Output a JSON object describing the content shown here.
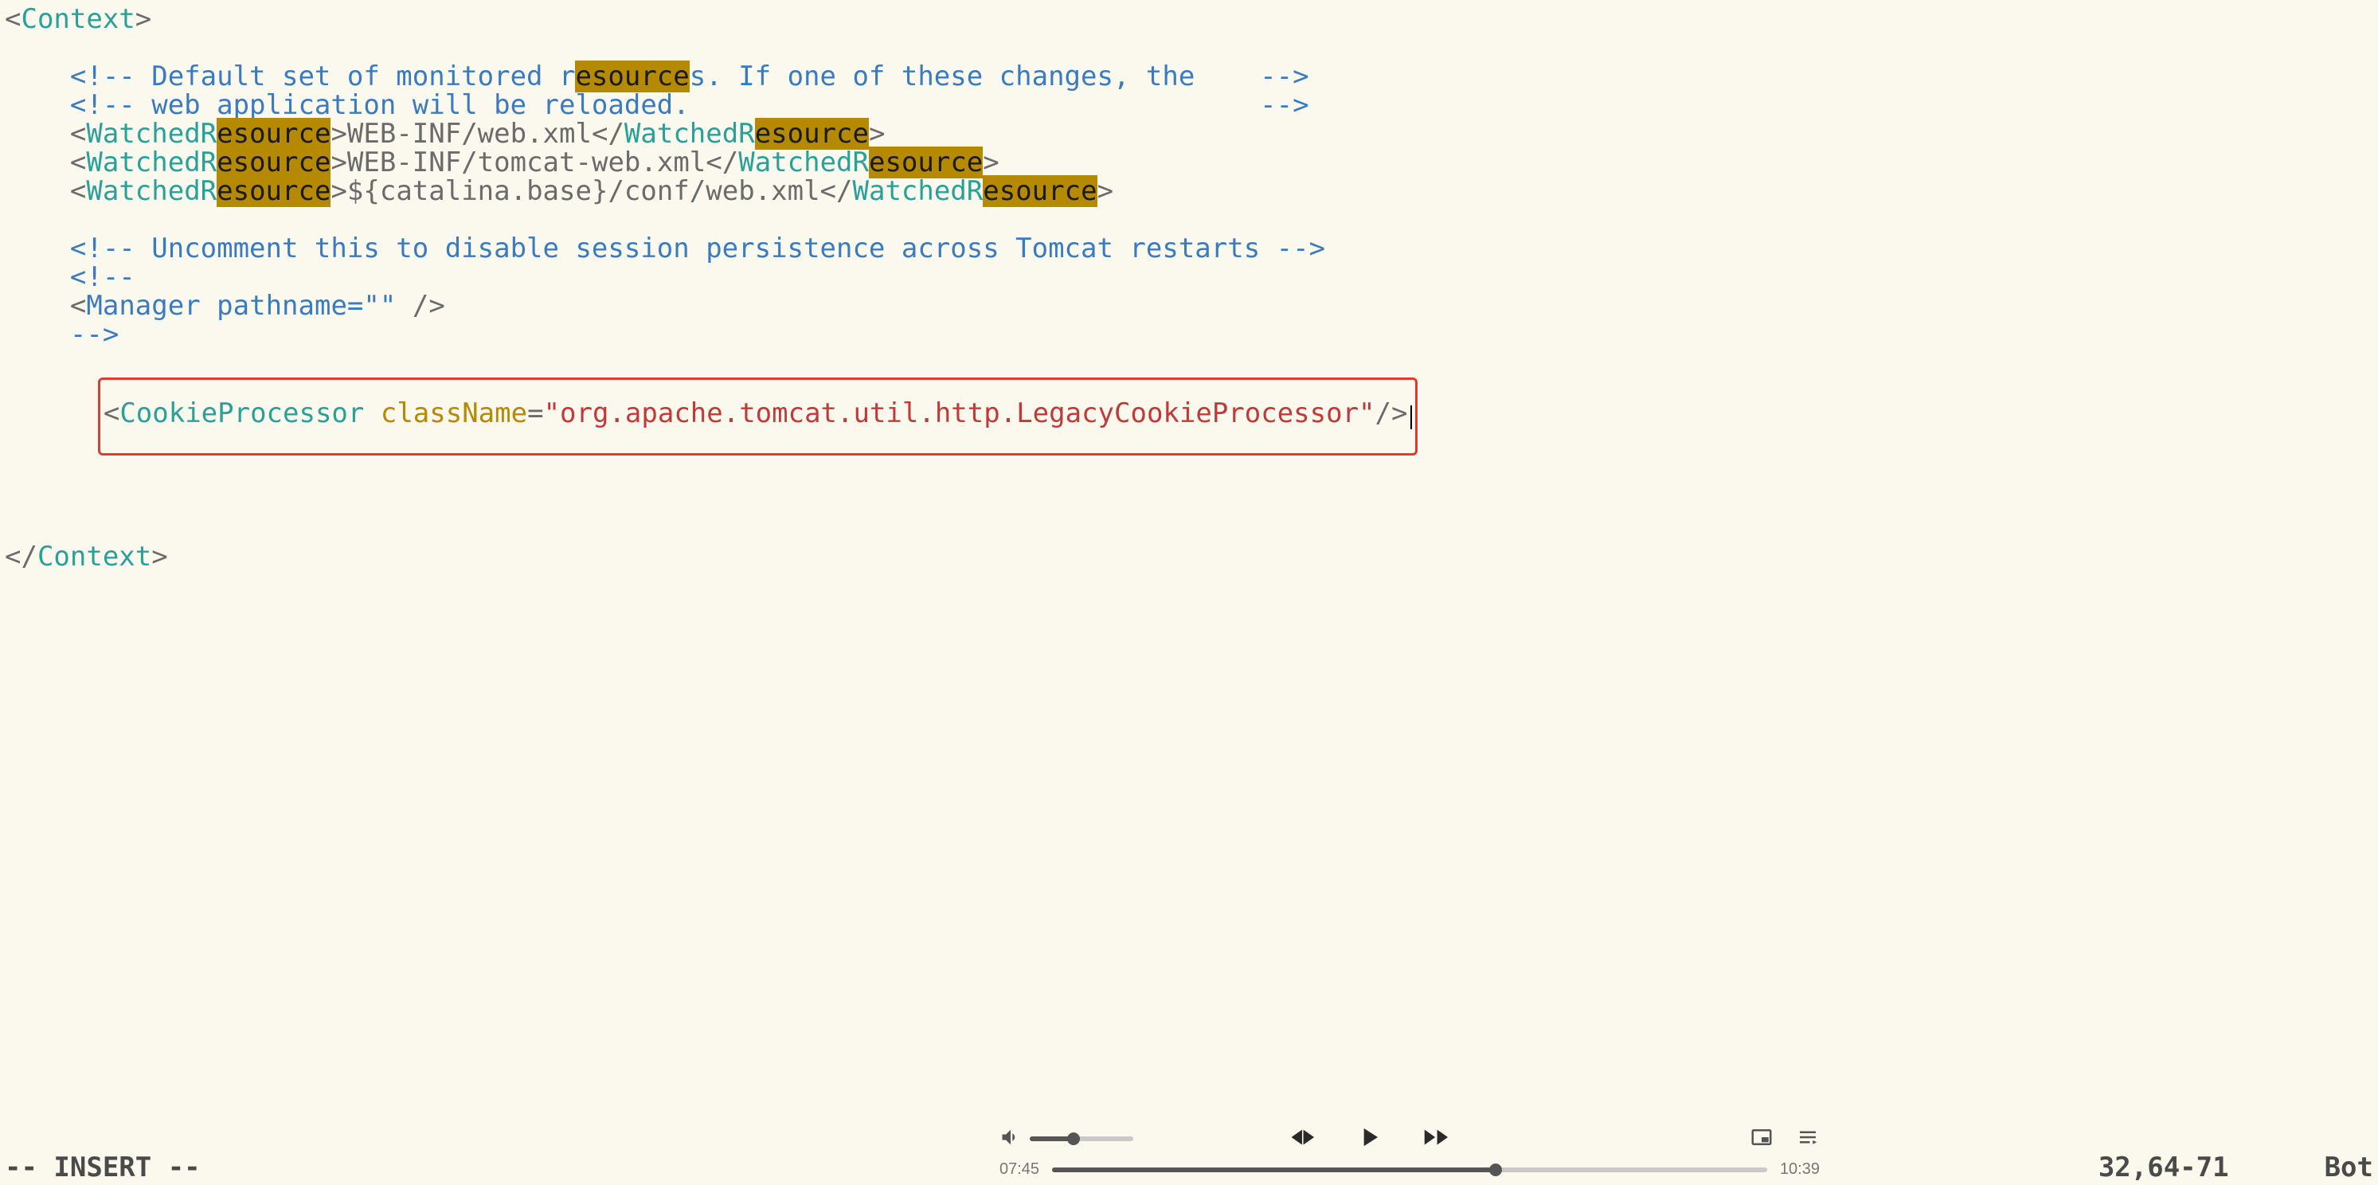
{
  "search_highlight": "esource",
  "code": {
    "context_open": "Context",
    "context_close": "Context",
    "comment1a": "<!-- Default set of monitored r",
    "comment1b": "s. If one of these changes, the    -->",
    "comment2": "<!-- web application will be reloaded.                                   -->",
    "wr_tag": "WatchedR",
    "wr_tag_tail": "",
    "wr1_text": "WEB-INF/web.xml",
    "wr2_text": "WEB-INF/tomcat-web.xml",
    "wr3_text": "${catalina.base}/conf/web.xml",
    "comment3": "<!-- Uncomment this to disable session persistence across Tomcat restarts -->",
    "comment4": "<!--",
    "mgr_tag": "Manager",
    "mgr_attr": "pathname",
    "mgr_val": "\"\"",
    "comment5": "-->",
    "cp_tag": "CookieProcessor",
    "cp_attr": "className",
    "cp_val": "\"org.apache.tomcat.util.http.LegacyCookieProcessor\""
  },
  "ruler": {
    "mode": "-- INSERT --",
    "pos": "32,64-71",
    "loc": "Bot"
  },
  "player": {
    "volume_pct": 42,
    "elapsed": "07:45",
    "total": "10:39",
    "seek_pct": 62
  }
}
